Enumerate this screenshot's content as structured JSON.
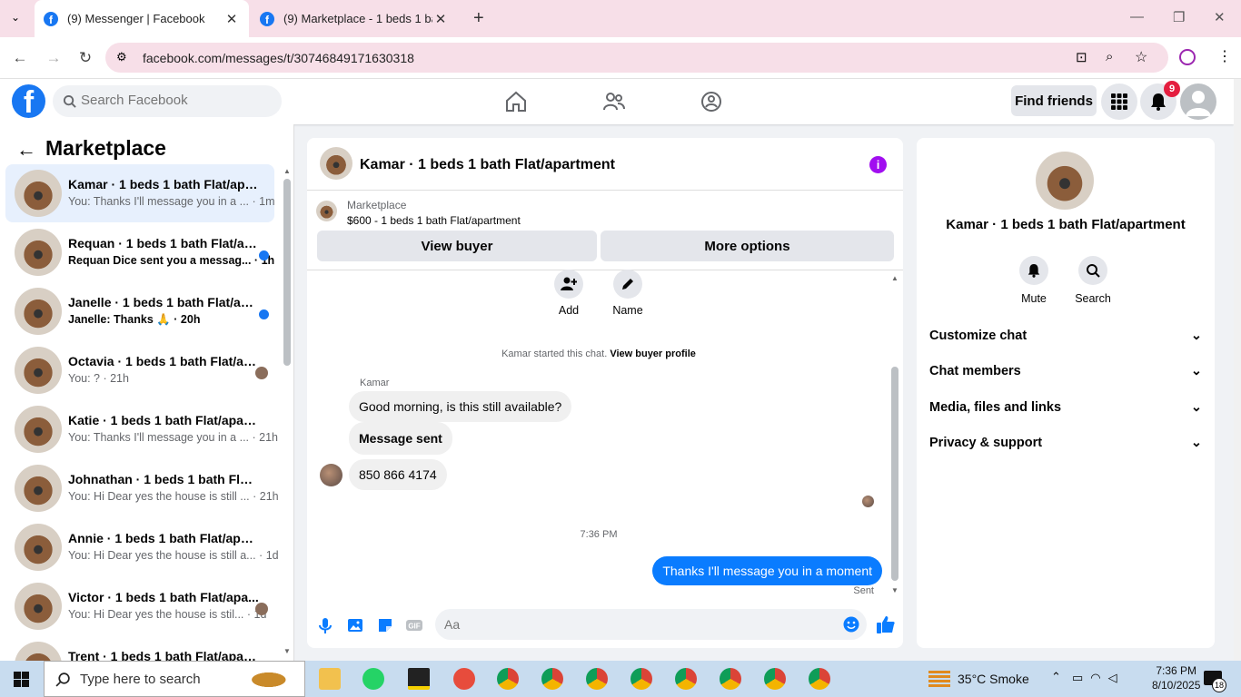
{
  "browser": {
    "tabs": [
      {
        "title": "(9) Messenger | Facebook"
      },
      {
        "title": "(9) Marketplace - 1 beds 1 bath"
      }
    ],
    "url": "facebook.com/messages/t/30746849171630318"
  },
  "fb": {
    "search_placeholder": "Search Facebook",
    "find_friends": "Find friends",
    "notif_count": "9"
  },
  "sidebar": {
    "title": "Marketplace",
    "conversations": [
      {
        "name": "Kamar · 1 beds 1 bath Flat/apart...",
        "preview": "You: Thanks I'll message you in a ... · 1m",
        "unread": false,
        "selected": true
      },
      {
        "name": "Requan · 1 beds 1 bath Flat/ap...",
        "preview": "Requan Dice sent you a messag... · 1h",
        "unread": true
      },
      {
        "name": "Janelle · 1 beds 1 bath Flat/apa...",
        "preview": "Janelle: Thanks 🙏 · 20h",
        "unread": true
      },
      {
        "name": "Octavia · 1 beds 1 bath Flat/ap...",
        "preview": "You: ? · 21h",
        "unread": false
      },
      {
        "name": "Katie · 1 beds 1 bath Flat/apartm...",
        "preview": "You: Thanks I'll message you in a ... · 21h",
        "unread": false
      },
      {
        "name": "Johnathan · 1 beds 1 bath Flat/a...",
        "preview": "You: Hi Dear yes the house is still ... · 21h",
        "unread": false
      },
      {
        "name": "Annie · 1 beds 1 bath Flat/apart...",
        "preview": "You: Hi Dear yes the house is still a... · 1d",
        "unread": false
      },
      {
        "name": "Victor · 1 beds 1 bath Flat/apa...",
        "preview": "You: Hi Dear yes the house is stil... · 1d",
        "unread": false
      },
      {
        "name": "Trent · 1 beds 1 bath Flat/apartm...",
        "preview": "",
        "unread": false
      }
    ]
  },
  "chat": {
    "title": "Kamar · 1 beds 1 bath Flat/apartment",
    "marketplace_label": "Marketplace",
    "listing": "$600 - 1 beds 1 bath Flat/apartment",
    "view_buyer": "View buyer",
    "more_options": "More options",
    "add_label": "Add",
    "name_label": "Name",
    "started_text": "Kamar started this chat.",
    "view_profile": "View buyer profile",
    "sender": "Kamar",
    "messages": [
      "Good morning, is this still available?",
      "Message sent",
      "850 866 4174"
    ],
    "timestamp": "7:36 PM",
    "my_message": "Thanks I'll message you in a moment",
    "sent_status": "Sent",
    "composer_placeholder": "Aa"
  },
  "details": {
    "name": "Kamar · 1 beds 1 bath Flat/apartment",
    "mute": "Mute",
    "search": "Search",
    "sections": [
      "Customize chat",
      "Chat members",
      "Media, files and links",
      "Privacy & support"
    ]
  },
  "taskbar": {
    "search_placeholder": "Type here to search",
    "weather": "35°C  Smoke",
    "time": "7:36 PM",
    "date": "8/10/2025",
    "notif": "18"
  }
}
